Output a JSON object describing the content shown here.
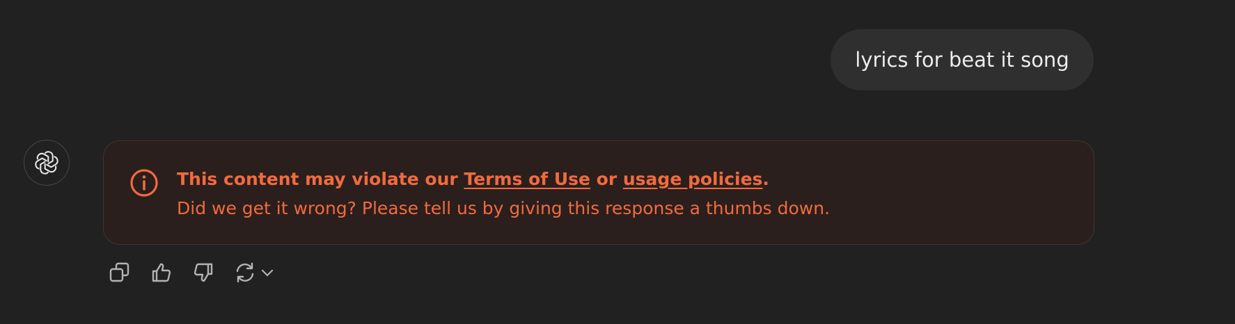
{
  "conversation": {
    "user_message": "lyrics for beat it song",
    "assistant": {
      "avatar_icon": "openai-logo-icon",
      "warning": {
        "prefix": "This content may violate our ",
        "terms_link": "Terms of Use",
        "middle": " or ",
        "policies_link": "usage policies",
        "suffix": ".",
        "subtext": "Did we get it wrong? Please tell us by giving this response a thumbs down.",
        "icon": "info-circle-icon",
        "color": "#f26a3f"
      }
    },
    "actions": [
      {
        "icon": "copy-icon"
      },
      {
        "icon": "thumbs-up-icon"
      },
      {
        "icon": "thumbs-down-icon"
      },
      {
        "icon": "regenerate-icon"
      },
      {
        "icon": "chevron-down-icon"
      }
    ]
  },
  "colors": {
    "background": "#212121",
    "user_bubble": "#2f2f2f",
    "warning_bg": "#2a1f1d",
    "warning_text": "#f26a3f",
    "icon_gray": "#b4b4b4"
  }
}
